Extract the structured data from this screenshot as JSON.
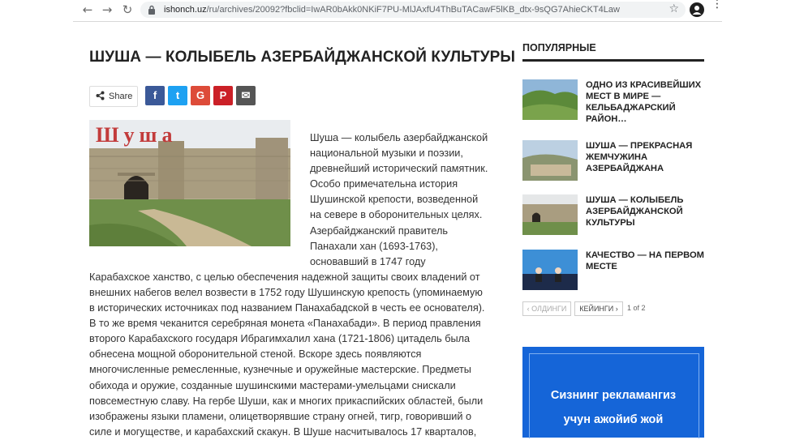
{
  "browser": {
    "url_host": "ishonch.uz",
    "url_path": "/ru/archives/20092?fbclid=IwAR0bAkk0NKiF7PU-MlJAxfU4ThBuTACawF5lKB_dtx-9sQG7AhieCKT4Law",
    "icons": [
      "back-icon",
      "forward-icon",
      "reload-icon",
      "lock-icon",
      "star-icon",
      "account-icon",
      "menu-icon"
    ]
  },
  "article": {
    "title": "ШУША — КОЛЫБЕЛЬ АЗЕРБАЙДЖАНСКОЙ КУЛЬТУРЫ",
    "share_label": "Share",
    "social": [
      {
        "name": "facebook",
        "glyph": "f",
        "color": "#3b5998"
      },
      {
        "name": "twitter",
        "glyph": "t",
        "color": "#1da1f2"
      },
      {
        "name": "google",
        "glyph": "G",
        "color": "#dd4b39"
      },
      {
        "name": "pinterest",
        "glyph": "P",
        "color": "#cb2027"
      },
      {
        "name": "email",
        "glyph": "✉",
        "color": "#555555"
      }
    ],
    "image_sign": "Шуша",
    "body": "Шуша — колыбель азербайджанской национальной музыки и поэзии, древнейший исторический памятник. Особо примечательна история Шушинской крепости, возведенной на севере в оборонительных целях. Азербайджанский правитель Панахали хан (1693-1763), основавший в 1747 году Карабахское ханство, с целью обеспечения надежной защиты своих владений от внешних набегов велел возвести в 1752 году Шушинскую крепость (упоминаемую в исторических источниках под названием Панахабадской в честь ее основателя). В то же время чеканится серебряная монета «Панахабади». В период правления второго Карабахского государя Ибрагимхалил хана (1721-1806) цитадель была обнесена мощной оборонительной стеной. Вскоре здесь появляются многочисленные ремесленные, кузнечные и оружейные мастерские. Предметы обихода и оружие, созданные шушинскими мастерами-умельцами снискали повсеместную славу. На гербе Шуши, как и многих прикаспийских областей, были изображены языки пламени, олицетворявшие страну огней, тигр, говоривший о силе и могуществе, и карабахский скакун. В Шуше насчитывалось 17 кварталов,"
  },
  "sidebar": {
    "heading": "ПОПУЛЯРНЫЕ",
    "posts": [
      {
        "title": "ОДНО ИЗ КРАСИВЕЙШИХ МЕСТ В МИРЕ — КЕЛЬБАДЖАРСКИЙ РАЙОН…"
      },
      {
        "title": "ШУША — ПРЕКРАСНАЯ ЖЕМЧУЖИНА АЗЕРБАЙДЖАНА"
      },
      {
        "title": "ШУША — КОЛЫБЕЛЬ АЗЕРБАЙДЖАНСКОЙ КУЛЬТУРЫ"
      },
      {
        "title": "КАЧЕСТВО — НА ПЕРВОМ МЕСТЕ"
      }
    ],
    "prev_label": "‹ ОЛДИНГИ",
    "next_label": "КЕЙИНГИ ›",
    "page_info": "1 of 2"
  },
  "ad": {
    "line1": "Сизнинг рекламангиз",
    "line2": "учун ажойиб жой",
    "color": "#1565d8"
  }
}
